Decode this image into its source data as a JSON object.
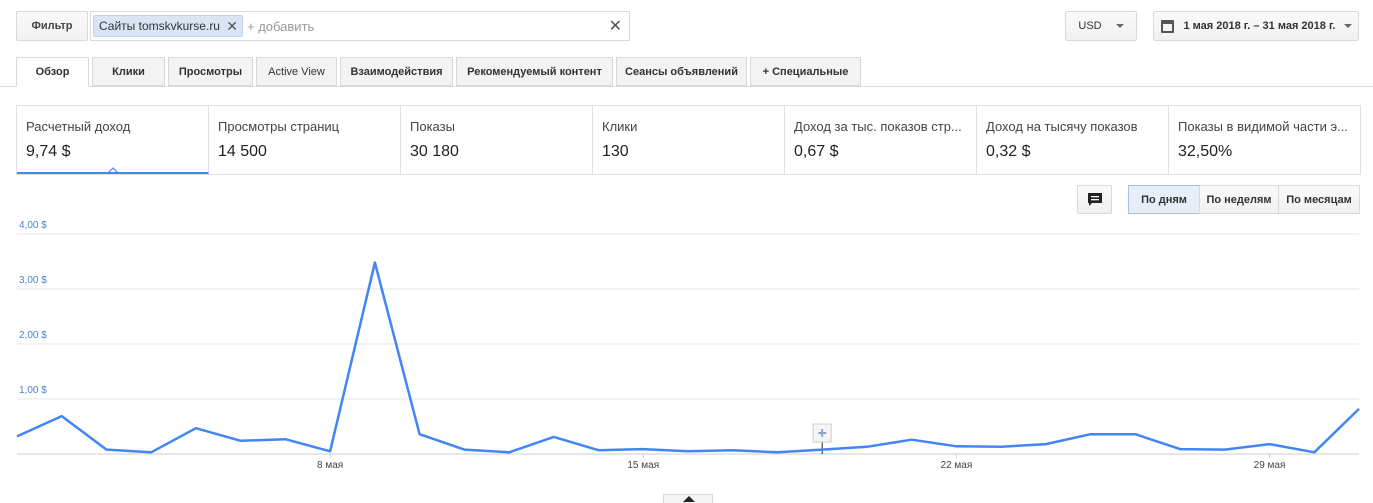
{
  "filter": {
    "button_label": "Фильтр",
    "chip_label": "Сайты tomskvkurse.ru",
    "add_placeholder": "+ добавить"
  },
  "currency": {
    "selected": "USD"
  },
  "date_range": {
    "label": "1 мая 2018 г. – 31 мая 2018 г."
  },
  "tabs": [
    {
      "label": "Обзор",
      "active": true
    },
    {
      "label": "Клики"
    },
    {
      "label": "Просмотры"
    },
    {
      "label": "Active View"
    },
    {
      "label": "Взаимодействия"
    },
    {
      "label": "Рекомендуемый контент"
    },
    {
      "label": "Сеансы объявлений"
    },
    {
      "label": "+ Специальные"
    }
  ],
  "metrics": [
    {
      "label": "Расчетный доход",
      "value": "9,74 $",
      "active": true
    },
    {
      "label": "Просмотры страниц",
      "value": "14 500"
    },
    {
      "label": "Показы",
      "value": "30 180"
    },
    {
      "label": "Клики",
      "value": "130"
    },
    {
      "label": "Доход за тыс. показов стр...",
      "value": "0,67 $"
    },
    {
      "label": "Доход на тысячу показов",
      "value": "0,32 $"
    },
    {
      "label": "Показы в видимой части э...",
      "value": "32,50%"
    }
  ],
  "granularity": {
    "day": "По дням",
    "week": "По неделям",
    "month": "По месяцам",
    "selected": "day"
  },
  "chart_data": {
    "type": "line",
    "x": [
      "1 мая",
      "2 мая",
      "3 мая",
      "4 мая",
      "5 мая",
      "6 мая",
      "7 мая",
      "8 мая",
      "9 мая",
      "10 мая",
      "11 мая",
      "12 мая",
      "13 мая",
      "14 мая",
      "15 мая",
      "16 мая",
      "17 мая",
      "18 мая",
      "19 мая",
      "20 мая",
      "21 мая",
      "22 мая",
      "23 мая",
      "24 мая",
      "25 мая",
      "26 мая",
      "27 мая",
      "28 мая",
      "29 мая",
      "30 мая",
      "31 мая"
    ],
    "values": [
      0.32,
      0.69,
      0.08,
      0.03,
      0.47,
      0.24,
      0.27,
      0.05,
      3.48,
      0.36,
      0.08,
      0.03,
      0.31,
      0.07,
      0.09,
      0.05,
      0.07,
      0.03,
      0.08,
      0.13,
      0.26,
      0.14,
      0.13,
      0.18,
      0.36,
      0.36,
      0.09,
      0.08,
      0.18,
      0.03,
      0.82
    ],
    "x_tick_labels": [
      {
        "index": 7,
        "label": "8 мая"
      },
      {
        "index": 14,
        "label": "15 мая"
      },
      {
        "index": 21,
        "label": "22 мая"
      },
      {
        "index": 28,
        "label": "29 мая"
      }
    ],
    "y_ticks": [
      {
        "value": 1,
        "label": "1,00 $"
      },
      {
        "value": 2,
        "label": "2,00 $"
      },
      {
        "value": 3,
        "label": "3,00 $"
      },
      {
        "value": 4,
        "label": "4,00 $"
      }
    ],
    "ylim": [
      0,
      4
    ],
    "annotation_marker_index": 18,
    "grid": true,
    "line_color": "#4285f4",
    "axis_label_color": "#4a7fd6"
  }
}
